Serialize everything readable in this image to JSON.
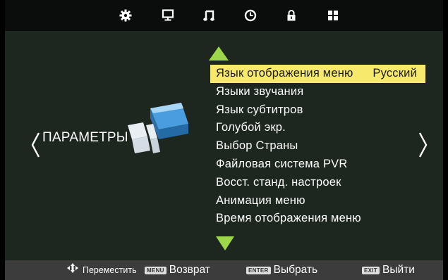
{
  "top_icons": [
    "gear-icon",
    "monitor-icon",
    "music-note-icon",
    "clock-icon",
    "lock-icon",
    "grid-icon"
  ],
  "section_title": "ПАРАМЕТРЫ",
  "menu": {
    "items": [
      {
        "label": "Язык отображения меню",
        "value": "Русский",
        "selected": true
      },
      {
        "label": "Языки звучания"
      },
      {
        "label": "Язык субтитров"
      },
      {
        "label": "Голубой экр."
      },
      {
        "label": "Выбор Страны"
      },
      {
        "label": "Файловая система PVR"
      },
      {
        "label": "Восст. станд. настроек"
      },
      {
        "label": "Анимация меню"
      },
      {
        "label": "Время отображения меню"
      }
    ]
  },
  "footer": {
    "move_label": "Переместить",
    "menu_key": "MENU",
    "back_label": "Возврат",
    "enter_key": "ENTER",
    "select_label": "Выбрать",
    "exit_key": "EXIT",
    "exit_label": "Выйти"
  },
  "colors": {
    "background": "#1d261f",
    "topbar": "#0a0d0b",
    "highlight": "#f7e96b",
    "scroll_arrow": "#9ed64a",
    "footer_bar": "#3c3c3c"
  }
}
